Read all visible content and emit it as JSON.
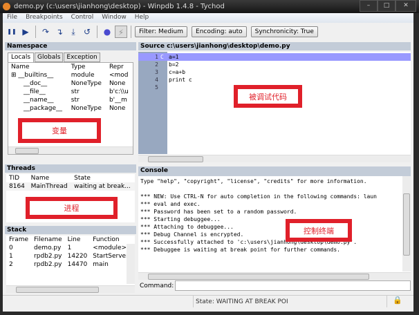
{
  "window": {
    "title": "demo.py (c:\\users\\jianhong\\desktop) - Winpdb 1.4.8 - Tychod",
    "controls": [
      "–",
      "□",
      "✕"
    ]
  },
  "menu": [
    "File",
    "Breakpoints",
    "Control",
    "Window",
    "Help"
  ],
  "toolbar": {
    "icons": [
      "pause-icon",
      "play-icon",
      "step-over-icon",
      "step-into-icon",
      "step-return-icon",
      "go-to-line-icon",
      "stop-icon",
      "lightning-icon"
    ],
    "glyphs": [
      "❚❚",
      "▶",
      "↷",
      "↴",
      "⤓",
      "↺",
      "●",
      "⚡"
    ],
    "filter": "Filter: Medium",
    "encoding": "Encoding: auto",
    "synchronicity": "Synchronicity: True"
  },
  "namespace": {
    "title": "Namespace",
    "tabs": [
      "Locals",
      "Globals",
      "Exception"
    ],
    "columns": [
      "Name",
      "Type",
      "Repr"
    ],
    "rows": [
      [
        "⊞ __builtins__",
        "module",
        "<mod"
      ],
      [
        "__doc__",
        "NoneType",
        "None"
      ],
      [
        "__file__",
        "str",
        "b'c:\\\\u"
      ],
      [
        "__name__",
        "str",
        "b'__m"
      ],
      [
        "__package__",
        "NoneType",
        "None"
      ]
    ],
    "annotation": "变量"
  },
  "threads": {
    "title": "Threads",
    "columns": [
      "TID",
      "Name",
      "State"
    ],
    "rows": [
      [
        "8164",
        "MainThread",
        "waiting at break..."
      ]
    ],
    "annotation": "进程"
  },
  "stack": {
    "title": "Stack",
    "columns": [
      "Frame",
      "Filename",
      "Line",
      "Function"
    ],
    "rows": [
      [
        "0",
        "demo.py",
        "1",
        "<module>"
      ],
      [
        "1",
        "rpdb2.py",
        "14220",
        "StartServer"
      ],
      [
        "2",
        "rpdb2.py",
        "14470",
        "main"
      ]
    ]
  },
  "source": {
    "title": "Source c:\\users\\jianhong\\desktop\\demo.py",
    "lines": [
      "a=1",
      "b=2",
      "c=a+b",
      "print c",
      ""
    ],
    "current_line": 1,
    "annotation": "被调试代码",
    "highlight": "#9999ff"
  },
  "console": {
    "title": "Console",
    "lines": [
      "Type \"help\", \"copyright\", \"license\", \"credits\" for more information.",
      "",
      "*** NEW: Use CTRL-N for auto completion in the following commands: laun",
      "*** eval and exec.",
      "*** Password has been set to a random password.",
      "*** Starting debuggee...",
      "*** Attaching to debuggee...",
      "*** Debug Channel is encrypted.",
      "*** Successfully attached to 'c:\\users\\jianhong\\desktop\\demo.py'.",
      "*** Debuggee is waiting at break point for further commands."
    ],
    "command_label": "Command:",
    "command_value": "",
    "annotation": "控制终端"
  },
  "status": {
    "state": "State: WAITING AT BREAK POI",
    "lock": "lock-icon"
  }
}
